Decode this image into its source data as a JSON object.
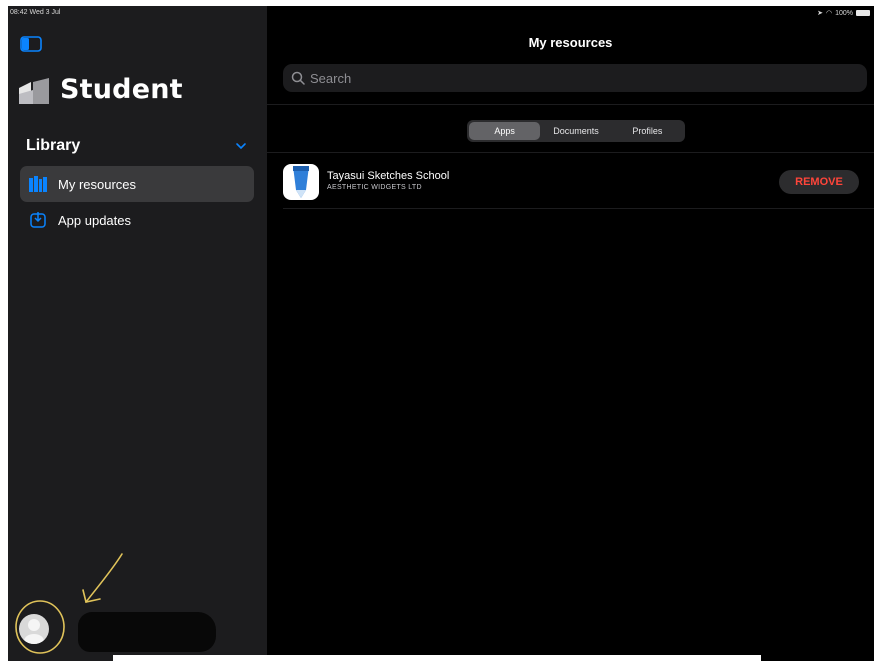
{
  "status_bar": {
    "time_date": "08:42  Wed 3 Jul",
    "battery": "100%",
    "icons": [
      "location-icon",
      "wifi-icon",
      "battery-icon"
    ]
  },
  "sidebar": {
    "toggle_icon": "sidebar-toggle-icon",
    "app_name": "Student",
    "library_heading": "Library",
    "items": [
      {
        "label": "My resources",
        "icon": "resources-icon",
        "selected": true
      },
      {
        "label": "App updates",
        "icon": "app-updates-icon",
        "selected": false
      }
    ]
  },
  "main": {
    "title": "My resources",
    "search": {
      "placeholder": "Search"
    },
    "segments": [
      {
        "label": "Apps",
        "selected": true
      },
      {
        "label": "Documents",
        "selected": false
      },
      {
        "label": "Profiles",
        "selected": false
      }
    ],
    "apps": [
      {
        "name": "Tayasui Sketches School",
        "developer": "AESTHETIC WIDGETS LTD",
        "action_label": "REMOVE"
      }
    ]
  },
  "colors": {
    "accent": "#0a84ff",
    "destructive": "#ff453a",
    "annotation": "#e0c35a",
    "sidebar_bg": "#1c1c1e",
    "main_bg": "#000000"
  }
}
